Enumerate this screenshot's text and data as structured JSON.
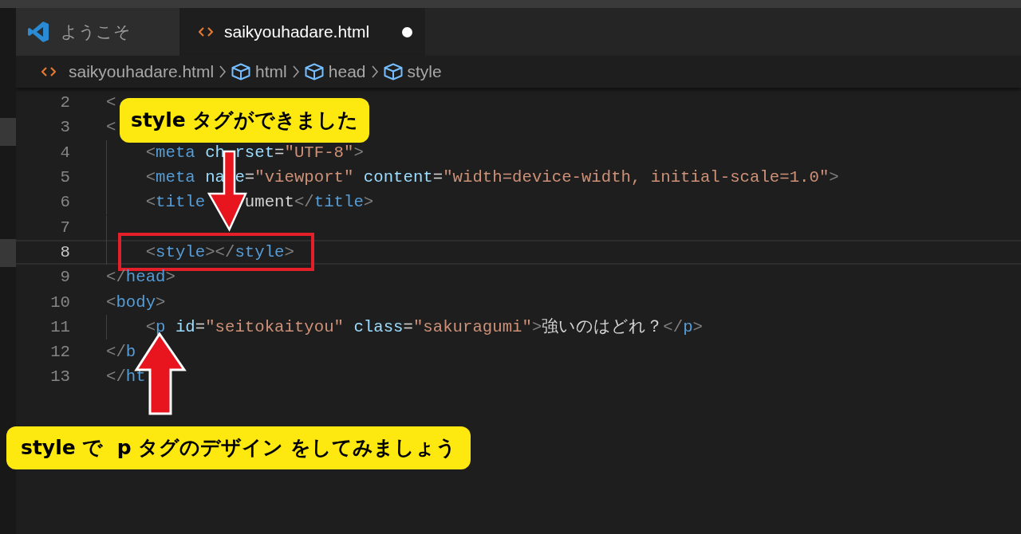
{
  "tabs": [
    {
      "label": "ようこそ",
      "kind": "welcome",
      "selected": false,
      "modified": false
    },
    {
      "label": "saikyouhadare.html",
      "kind": "html",
      "selected": true,
      "modified": true
    }
  ],
  "breadcrumbs": [
    {
      "label": "saikyouhadare.html",
      "kind": "file"
    },
    {
      "label": "html",
      "kind": "element"
    },
    {
      "label": "head",
      "kind": "element"
    },
    {
      "label": "style",
      "kind": "element"
    }
  ],
  "editor": {
    "lines": [
      {
        "number": "2",
        "current": false,
        "indented": false,
        "boxed": false,
        "segments": [
          {
            "kind": "start",
            "tokens": [
              {
                "text": "<",
                "kind": "punct"
              }
            ]
          }
        ]
      },
      {
        "number": "3",
        "current": false,
        "indented": false,
        "boxed": false,
        "segments": [
          {
            "kind": "start",
            "tokens": [
              {
                "text": "<",
                "kind": "punct"
              }
            ]
          }
        ]
      },
      {
        "number": "4",
        "current": false,
        "indented": true,
        "boxed": false,
        "segments": [
          {
            "kind": "start",
            "tokens": [
              {
                "text": "<",
                "kind": "punct"
              },
              {
                "text": "meta",
                "kind": "tag"
              },
              {
                "text": " ch",
                "kind": "attr"
              }
            ]
          },
          {
            "kind": "resume-narrow",
            "tokens": [
              {
                "text": "rset",
                "kind": "attr"
              },
              {
                "text": "=",
                "kind": "plain"
              },
              {
                "text": "\"UTF-8\"",
                "kind": "str"
              },
              {
                "text": ">",
                "kind": "punct"
              }
            ]
          }
        ]
      },
      {
        "number": "5",
        "current": false,
        "indented": true,
        "boxed": false,
        "segments": [
          {
            "kind": "start",
            "tokens": [
              {
                "text": "<",
                "kind": "punct"
              },
              {
                "text": "meta",
                "kind": "tag"
              },
              {
                "text": " na",
                "kind": "attr"
              }
            ]
          },
          {
            "kind": "resume-narrow",
            "tokens": [
              {
                "text": "e",
                "kind": "attr"
              },
              {
                "text": "=",
                "kind": "plain"
              },
              {
                "text": "\"viewport\"",
                "kind": "str"
              },
              {
                "text": " content",
                "kind": "attr"
              },
              {
                "text": "=",
                "kind": "plain"
              },
              {
                "text": "\"width=device-width, initial-scale=1.0\"",
                "kind": "str"
              },
              {
                "text": ">",
                "kind": "punct"
              }
            ]
          }
        ]
      },
      {
        "number": "6",
        "current": false,
        "indented": true,
        "boxed": false,
        "segments": [
          {
            "kind": "start",
            "tokens": [
              {
                "text": "<",
                "kind": "punct"
              },
              {
                "text": "title",
                "kind": "tag"
              }
            ]
          },
          {
            "kind": "resume-wide",
            "tokens": [
              {
                "text": "ument",
                "kind": "plain"
              },
              {
                "text": "</",
                "kind": "punct"
              },
              {
                "text": "title",
                "kind": "tag"
              },
              {
                "text": ">",
                "kind": "punct"
              }
            ]
          }
        ]
      },
      {
        "number": "7",
        "current": false,
        "indented": true,
        "boxed": false
      },
      {
        "number": "8",
        "current": true,
        "indented": true,
        "boxed": true,
        "segments": [
          {
            "kind": "start",
            "tokens": [
              {
                "text": "<",
                "kind": "punct"
              },
              {
                "text": "style",
                "kind": "tag"
              },
              {
                "text": "></",
                "kind": "punct"
              },
              {
                "text": "style",
                "kind": "tag"
              },
              {
                "text": ">",
                "kind": "punct"
              }
            ]
          }
        ]
      },
      {
        "number": "9",
        "current": false,
        "indented": false,
        "boxed": false,
        "segments": [
          {
            "kind": "start",
            "tokens": [
              {
                "text": "</",
                "kind": "punct"
              },
              {
                "text": "head",
                "kind": "tag"
              },
              {
                "text": ">",
                "kind": "punct"
              }
            ]
          }
        ]
      },
      {
        "number": "10",
        "current": false,
        "indented": false,
        "boxed": false,
        "segments": [
          {
            "kind": "start",
            "tokens": [
              {
                "text": "<",
                "kind": "punct"
              },
              {
                "text": "body",
                "kind": "tag"
              },
              {
                "text": ">",
                "kind": "punct"
              }
            ]
          }
        ]
      },
      {
        "number": "11",
        "current": false,
        "indented": true,
        "boxed": false,
        "segments": [
          {
            "kind": "start",
            "tokens": [
              {
                "text": "<",
                "kind": "punct"
              },
              {
                "text": "p",
                "kind": "tag"
              },
              {
                "text": " id",
                "kind": "attr"
              },
              {
                "text": "=",
                "kind": "plain"
              },
              {
                "text": "\"seitokaityou\"",
                "kind": "str"
              },
              {
                "text": " class",
                "kind": "attr"
              },
              {
                "text": "=",
                "kind": "plain"
              },
              {
                "text": "\"sakuragumi\"",
                "kind": "str"
              },
              {
                "text": ">",
                "kind": "punct"
              },
              {
                "text": "強いのはどれ？",
                "kind": "plain"
              },
              {
                "text": "</",
                "kind": "punct"
              },
              {
                "text": "p",
                "kind": "tag"
              },
              {
                "text": ">",
                "kind": "punct"
              }
            ]
          }
        ]
      },
      {
        "number": "12",
        "current": false,
        "indented": false,
        "boxed": false,
        "segments": [
          {
            "kind": "start",
            "tokens": [
              {
                "text": "</",
                "kind": "punct"
              },
              {
                "text": "b",
                "kind": "tag"
              }
            ]
          }
        ]
      },
      {
        "number": "13",
        "current": false,
        "indented": false,
        "boxed": false,
        "segments": [
          {
            "kind": "start",
            "tokens": [
              {
                "text": "</",
                "kind": "punct"
              },
              {
                "text": "ht",
                "kind": "tag"
              }
            ]
          }
        ]
      }
    ]
  },
  "callouts": [
    {
      "text": "style タグができました",
      "kind": "top"
    },
    {
      "text": "style で  p タグのデザイン をしてみましょう",
      "kind": "bottom"
    }
  ]
}
